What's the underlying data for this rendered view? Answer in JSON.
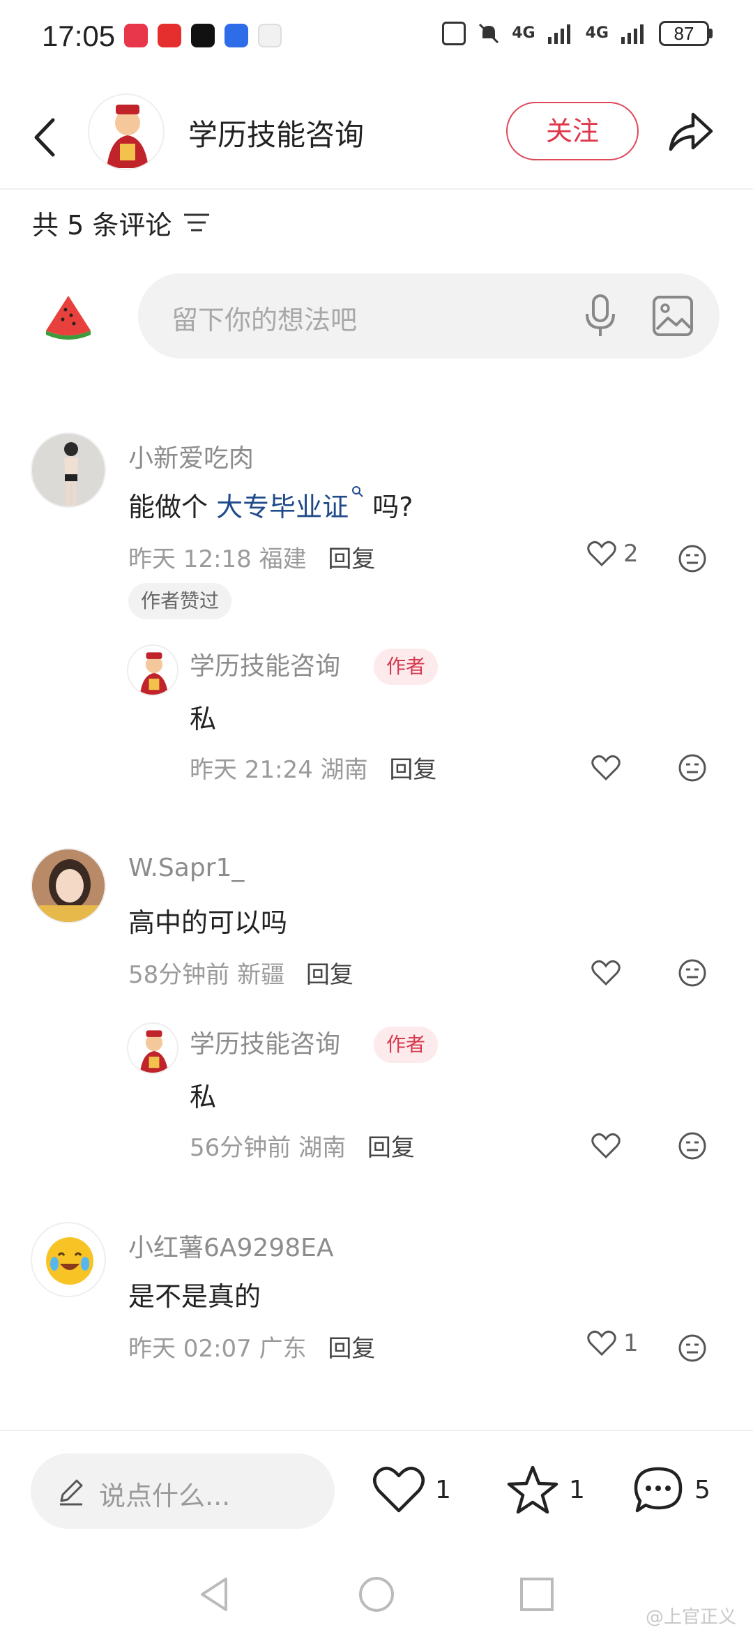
{
  "status_bar": {
    "time": "17:05",
    "network1": "4G",
    "network2": "4G",
    "battery": "87"
  },
  "header": {
    "title": "学历技能咨询",
    "follow_label": "关注"
  },
  "comments_header": {
    "count_text": "共 5 条评论"
  },
  "input": {
    "placeholder": "留下你的想法吧"
  },
  "comments": [
    {
      "user": "小新爱吃肉",
      "text_before": "能做个 ",
      "text_link": "大专毕业证",
      "text_after": " 吗?",
      "time": "昨天 12:18",
      "location": "福建",
      "reply_label": "回复",
      "likes": "2",
      "badge": "作者赞过",
      "replies": [
        {
          "user": "学历技能咨询",
          "badge": "作者",
          "text": "私",
          "time": "昨天 21:24",
          "location": "湖南",
          "reply_label": "回复"
        }
      ]
    },
    {
      "user": "W.Sapr1_",
      "text": "高中的可以吗",
      "time": "58分钟前",
      "location": "新疆",
      "reply_label": "回复",
      "replies": [
        {
          "user": "学历技能咨询",
          "badge": "作者",
          "text": "私",
          "time": "56分钟前",
          "location": "湖南",
          "reply_label": "回复"
        }
      ]
    },
    {
      "user": "小红薯6A9298EA",
      "text": "是不是真的",
      "time": "昨天 02:07",
      "location": "广东",
      "reply_label": "回复",
      "likes": "1"
    }
  ],
  "bottom_bar": {
    "say_placeholder": "说点什么...",
    "like_count": "1",
    "star_count": "1",
    "comment_count": "5"
  },
  "watermark": "@上官正义",
  "colors": {
    "accent": "#e0364b",
    "link": "#1f4a8a"
  }
}
